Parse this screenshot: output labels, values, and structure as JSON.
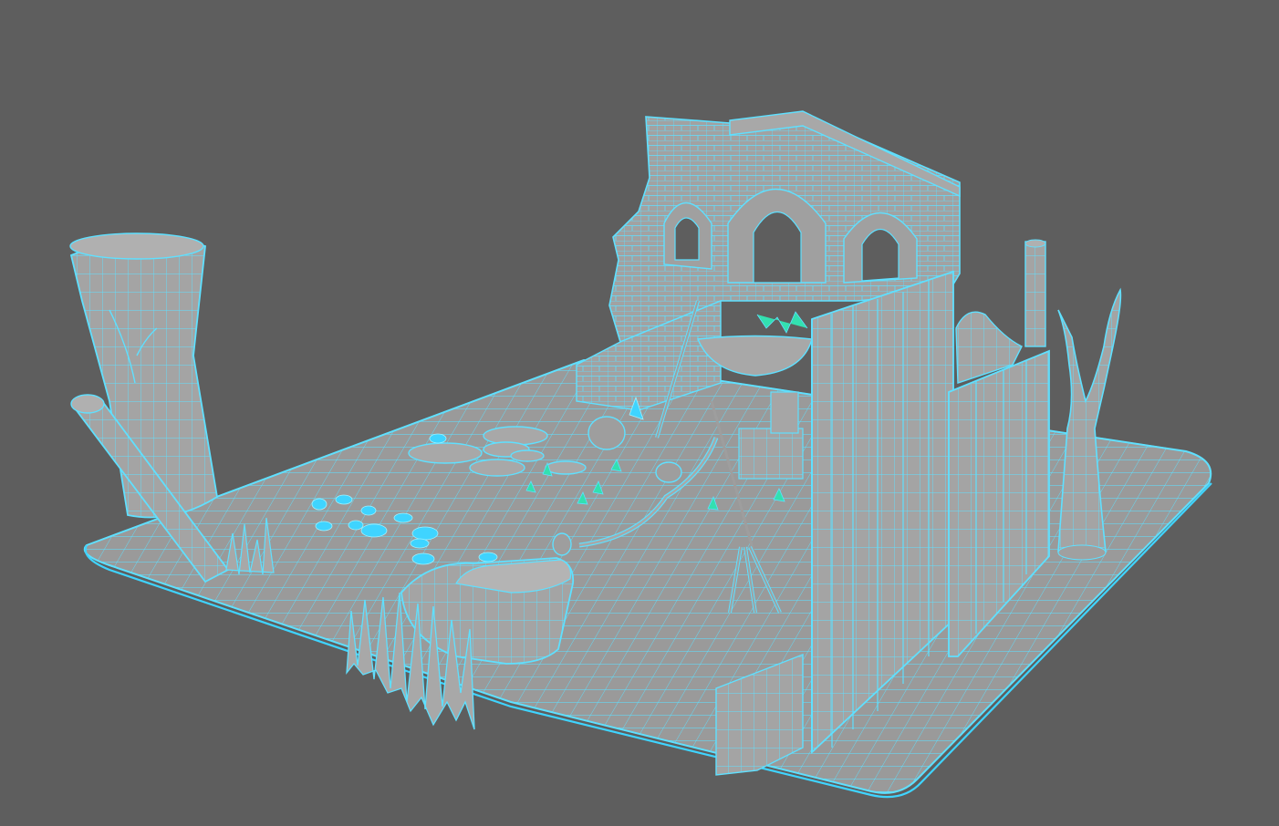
{
  "viewport": {
    "background": "#5e5e5e",
    "wireframe_color": "#5fe0ff",
    "surface_color": "#9e9e9e",
    "selection_mode": "wireframe-on-shaded"
  },
  "scene": {
    "objects": [
      "ground-plane",
      "ruined-wall-with-arches",
      "tree-stump-left",
      "fallen-log",
      "stone-block-front",
      "tall-grass-front",
      "wooden-fence-right",
      "dead-tree-right",
      "chimney-pole",
      "tripod-cauldron",
      "stepping-stones",
      "lily-pads",
      "small-plants"
    ]
  }
}
